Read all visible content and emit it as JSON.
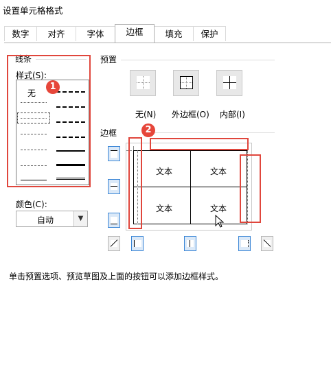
{
  "window": {
    "title": "设置单元格格式"
  },
  "tabs": [
    {
      "label": "数字"
    },
    {
      "label": "对齐"
    },
    {
      "label": "字体"
    },
    {
      "label": "边框",
      "active": true
    },
    {
      "label": "填充"
    },
    {
      "label": "保护"
    }
  ],
  "line_group": {
    "title": "线条",
    "style_label": "样式(S):",
    "none_label": "无",
    "color_label": "颜色(C):",
    "color_value": "自动"
  },
  "presets": {
    "title": "预置",
    "items": [
      {
        "label": "无(N)"
      },
      {
        "label": "外边框(O)"
      },
      {
        "label": "内部(I)"
      }
    ]
  },
  "border": {
    "title": "边框",
    "preview_cells": [
      "文本",
      "文本",
      "文本",
      "文本"
    ]
  },
  "annotations": {
    "badge1": "1",
    "badge2": "2"
  },
  "hint": "单击预置选项、预览草图及上面的按钮可以添加边框样式。",
  "colors": {
    "accent": "#3b86d6",
    "annotation_red": "#e0463c"
  }
}
